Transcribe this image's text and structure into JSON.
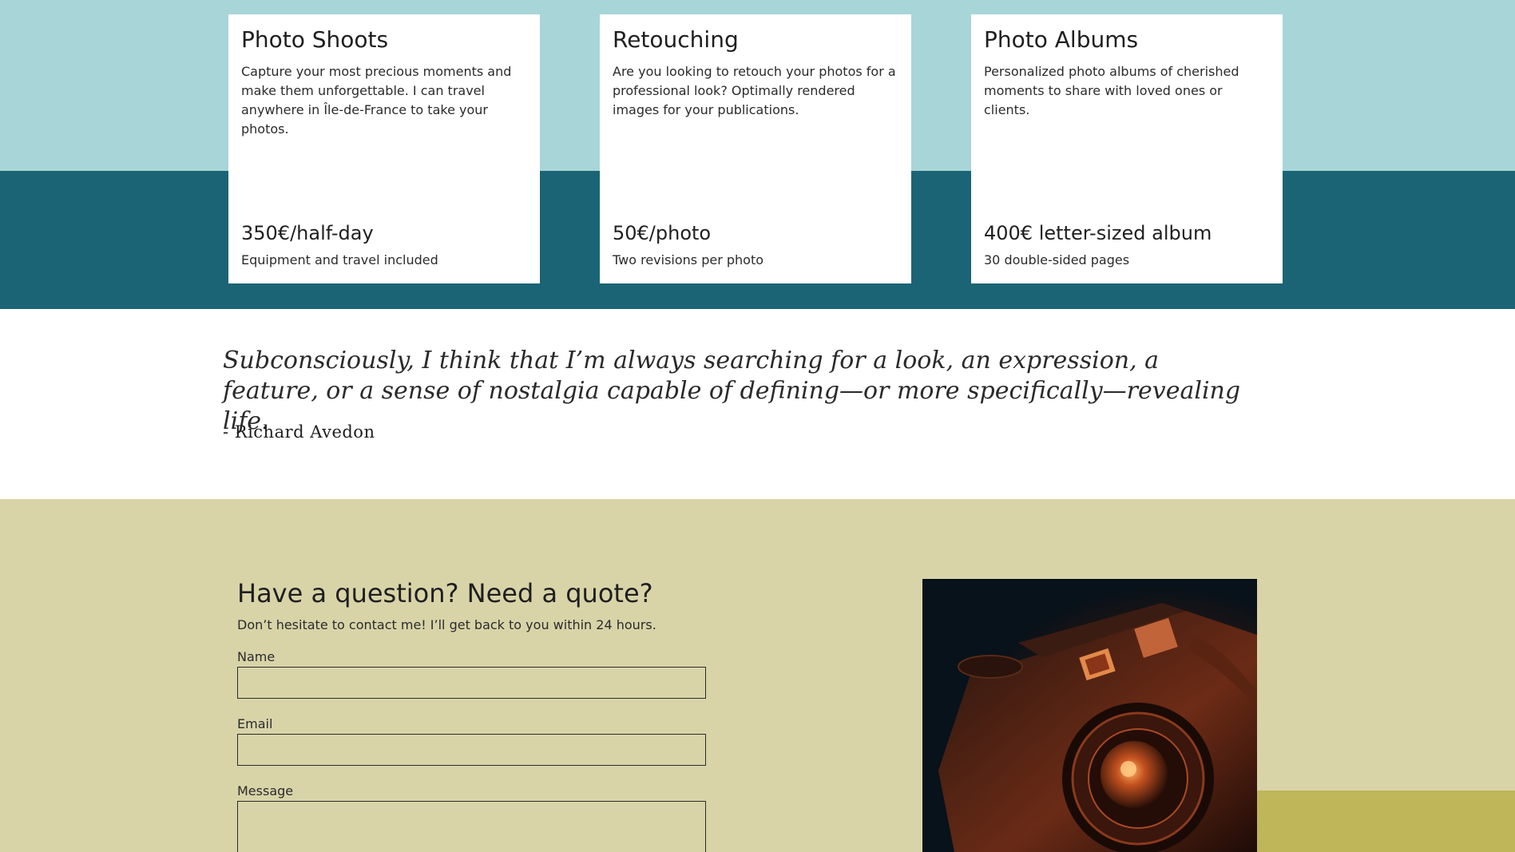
{
  "services": {
    "cards": [
      {
        "title": "Photo Shoots",
        "description": "Capture your most precious moments and make them unforgettable. I can travel anywhere in Île-de-France to take your photos.",
        "price": "350€/half-day",
        "note": "Equipment and travel included"
      },
      {
        "title": "Retouching",
        "description": "Are you looking to retouch your photos for a professional look? Optimally rendered images for your publications.",
        "price": "50€/photo",
        "note": "Two revisions per photo"
      },
      {
        "title": "Photo Albums",
        "description": "Personalized photo albums of cherished moments to share with loved ones or clients.",
        "price": "400€ letter-sized album",
        "note": "30 double-sided pages"
      }
    ]
  },
  "quote": {
    "text": "Subconsciously, I think that I’m always searching for a look, an expression, a feature, or a sense of nostalgia capable of defining—or more specifically—revealing life.",
    "author": "- Richard Avedon"
  },
  "contact": {
    "heading": "Have a question? Need a quote?",
    "lead": "Don’t hesitate to contact me! I’ll get back to you within 24 hours.",
    "fields": {
      "name_label": "Name",
      "email_label": "Email",
      "message_label": "Message"
    },
    "photo_icon": "camera-photo"
  },
  "colors": {
    "services_top": "#a8d5d8",
    "services_bottom": "#1b6475",
    "contact_bg": "#d8d4a8",
    "accent": "#bfb65a"
  }
}
